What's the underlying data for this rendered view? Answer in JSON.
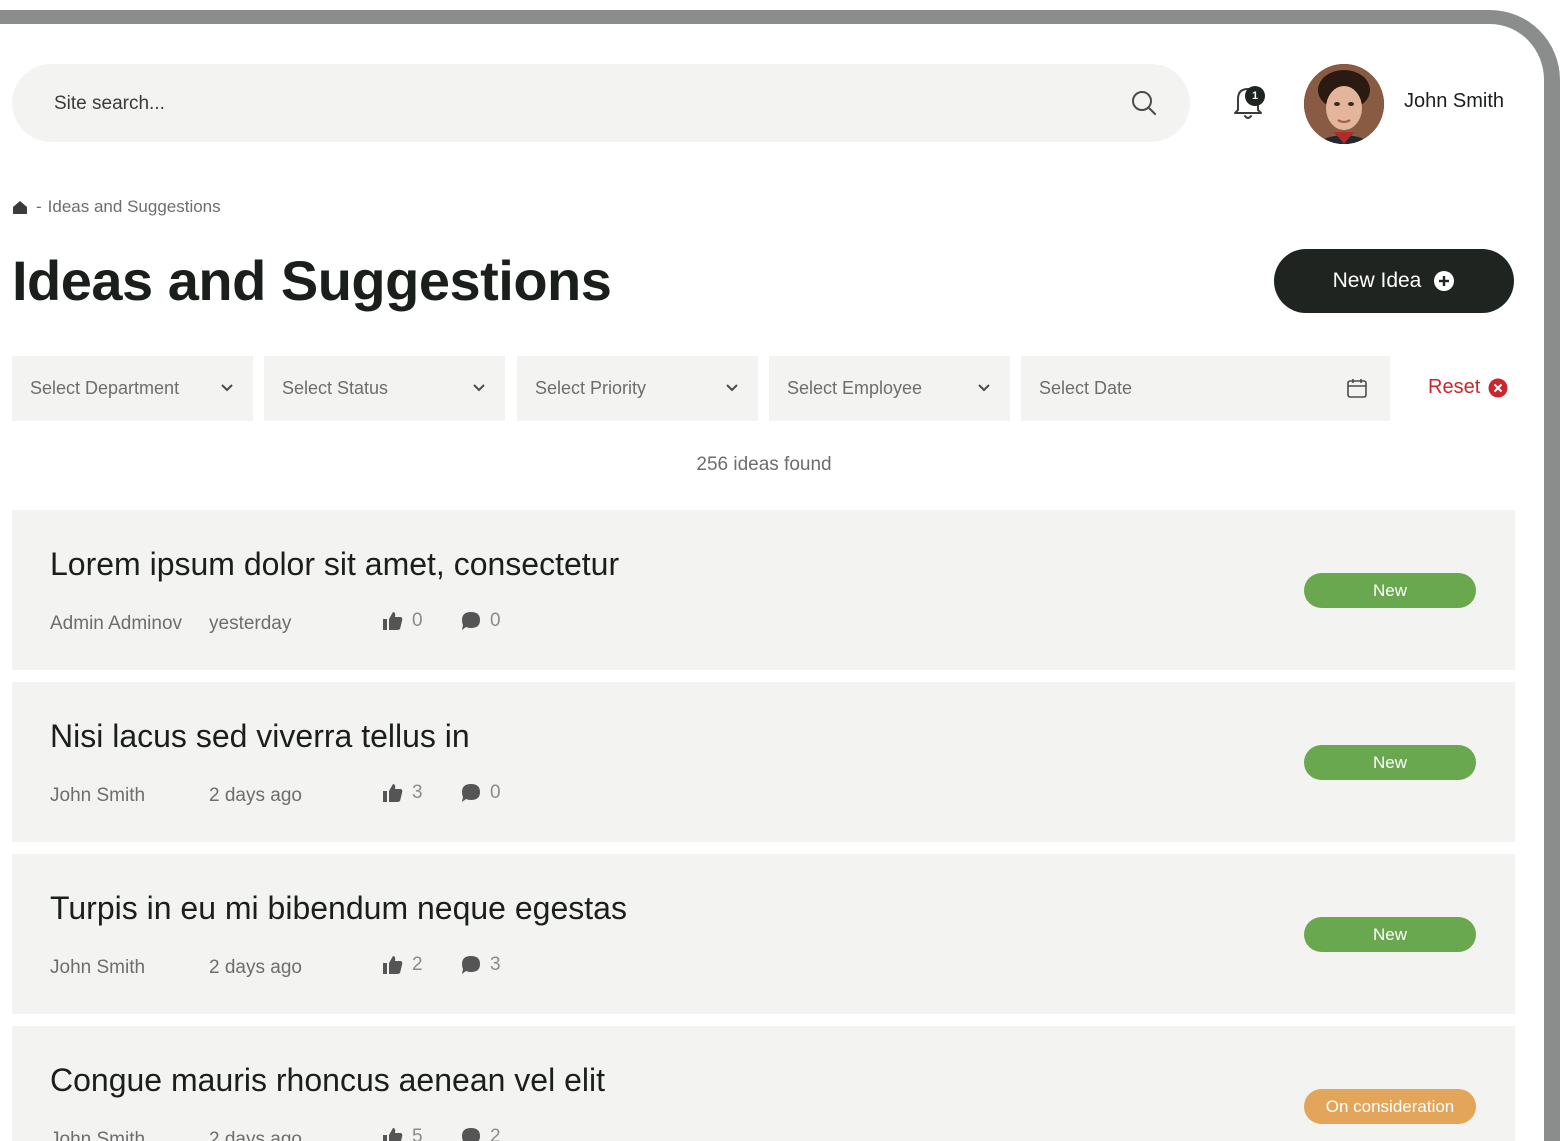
{
  "header": {
    "search_placeholder": "Site search...",
    "notification_count": "1",
    "user_name": "John Smith"
  },
  "breadcrumb": {
    "separator": "-",
    "current": "Ideas and Suggestions"
  },
  "page": {
    "title": "Ideas and Suggestions",
    "new_idea_label": "New Idea"
  },
  "filters": {
    "department": "Select Department",
    "status": "Select Status",
    "priority": "Select Priority",
    "employee": "Select Employee",
    "date": "Select Date",
    "reset_label": "Reset"
  },
  "results": {
    "found_text": "256 ideas found"
  },
  "colors": {
    "status_new": "#6aa84f",
    "status_consideration": "#e2a55a",
    "primary_dark": "#1f2420",
    "reset_red": "#c8282d"
  },
  "ideas": [
    {
      "title": "Lorem ipsum dolor sit amet, consectetur",
      "author": "Admin Adminov",
      "time": "yesterday",
      "likes": "0",
      "comments": "0",
      "status": "New"
    },
    {
      "title": "Nisi lacus sed viverra tellus in",
      "author": "John Smith",
      "time": "2 days ago",
      "likes": "3",
      "comments": "0",
      "status": "New"
    },
    {
      "title": "Turpis in eu mi bibendum neque egestas",
      "author": "John Smith",
      "time": "2 days ago",
      "likes": "2",
      "comments": "3",
      "status": "New"
    },
    {
      "title": "Congue mauris rhoncus aenean vel elit",
      "author": "John Smith",
      "time": "2 days ago",
      "likes": "5",
      "comments": "2",
      "status": "On consideration"
    }
  ]
}
